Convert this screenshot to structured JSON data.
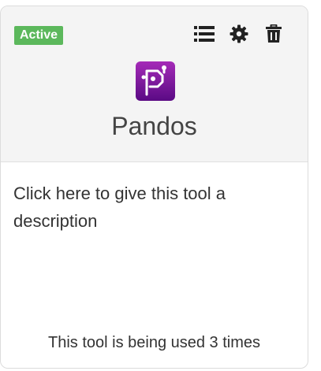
{
  "card": {
    "status": "Active",
    "tool_name": "Pandos",
    "description_prompt": "Click here to give this tool a description",
    "usage_text": "This tool is being used 3 times",
    "actions": {
      "list_icon": "list-icon",
      "settings_icon": "gear-icon",
      "delete_icon": "trash-icon"
    },
    "logo_icon": "pandos-logo-icon"
  },
  "colors": {
    "status_active": "#5cb85c",
    "header_bg": "#f4f4f4",
    "logo_gradient_start": "#9b27b0",
    "logo_gradient_end": "#5e0b86"
  }
}
